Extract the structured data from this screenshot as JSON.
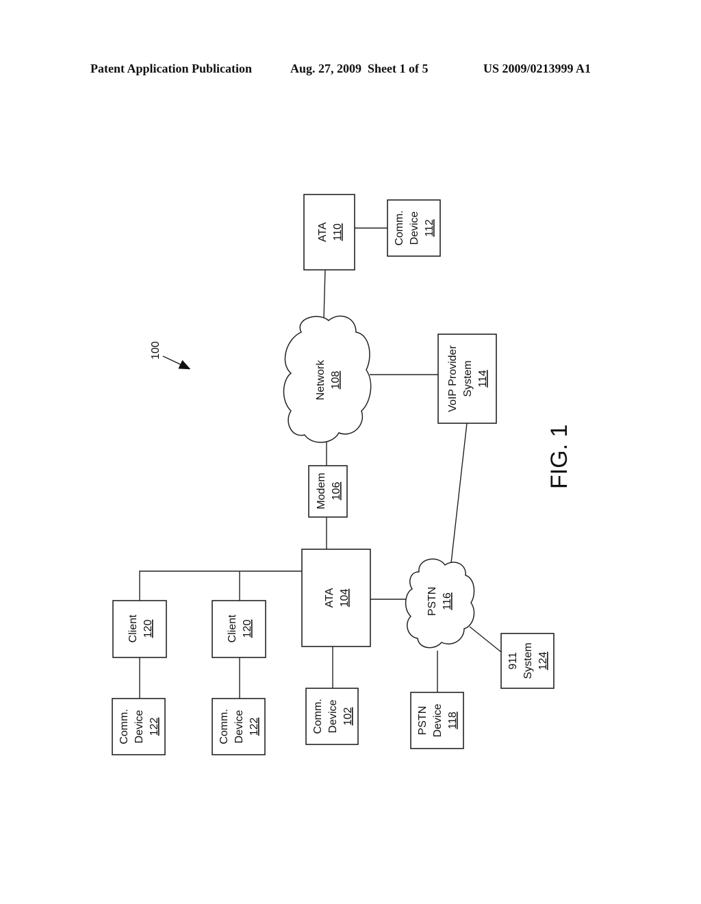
{
  "header": {
    "publication": "Patent Application Publication",
    "date_sheet": "Aug. 27, 2009  Sheet 1 of 5",
    "number": "US 2009/0213999 A1"
  },
  "figure": {
    "label": "FIG. 1",
    "ref": "100"
  },
  "nodes": {
    "ata110": {
      "lines": [
        "ATA"
      ],
      "ref": "110"
    },
    "comm112": {
      "lines": [
        "Comm.",
        "Device"
      ],
      "ref": "112"
    },
    "network108": {
      "lines": [
        "Network"
      ],
      "ref": "108"
    },
    "voip114": {
      "lines": [
        "VoIP Provider",
        "System"
      ],
      "ref": "114"
    },
    "modem106": {
      "lines": [
        "Modem"
      ],
      "ref": "106"
    },
    "ata104": {
      "lines": [
        "ATA"
      ],
      "ref": "104"
    },
    "client120a": {
      "lines": [
        "Client"
      ],
      "ref": "120"
    },
    "client120b": {
      "lines": [
        "Client"
      ],
      "ref": "120"
    },
    "pstn116": {
      "lines": [
        "PSTN"
      ],
      "ref": "116"
    },
    "sys124": {
      "lines": [
        "911",
        "System"
      ],
      "ref": "124"
    },
    "comm122a": {
      "lines": [
        "Comm.",
        "Device"
      ],
      "ref": "122"
    },
    "comm122b": {
      "lines": [
        "Comm.",
        "Device"
      ],
      "ref": "122"
    },
    "comm102": {
      "lines": [
        "Comm.",
        "Device"
      ],
      "ref": "102"
    },
    "pstn118": {
      "lines": [
        "PSTN",
        "Device"
      ],
      "ref": "118"
    }
  }
}
